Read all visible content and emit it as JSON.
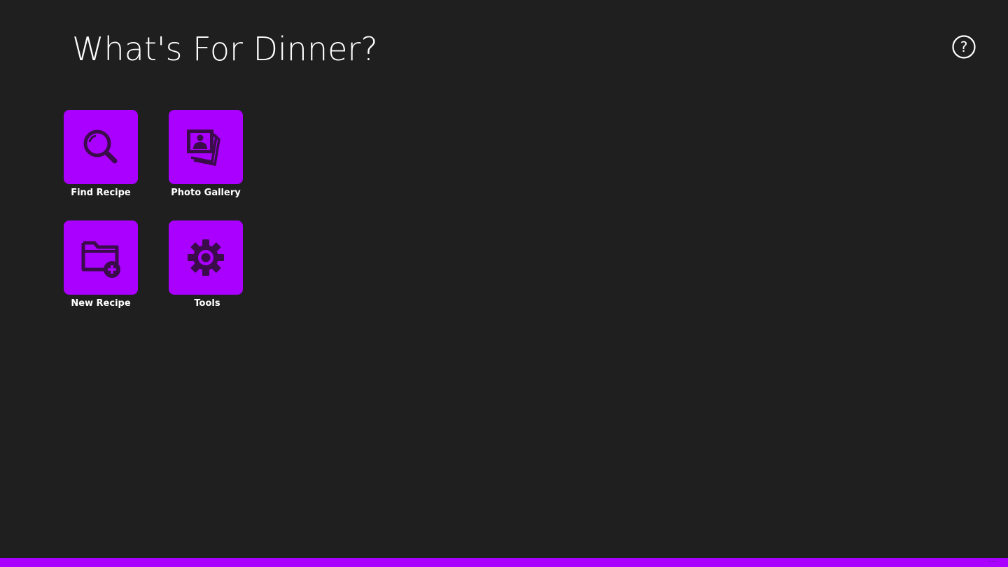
{
  "app": {
    "title": "What's For Dinner?",
    "accent_color": "#aa00ff",
    "background_color": "#1f1f1f"
  },
  "header": {
    "help_icon": "question-circle-icon"
  },
  "tiles": [
    {
      "label": "Find Recipe",
      "icon": "search-icon"
    },
    {
      "label": "Photo Gallery",
      "icon": "photo-gallery-icon"
    },
    {
      "label": "New Recipe",
      "icon": "new-folder-icon"
    },
    {
      "label": "Tools",
      "icon": "gear-icon"
    }
  ],
  "app_bar": {
    "more_label": "..."
  }
}
